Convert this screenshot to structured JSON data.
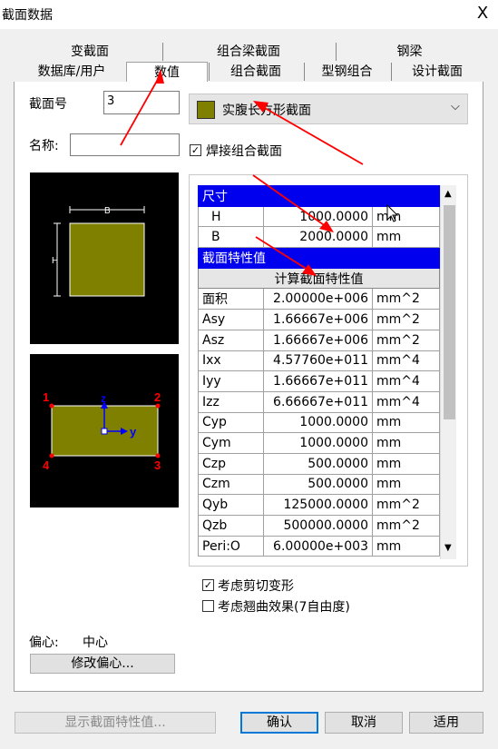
{
  "window": {
    "title": "截面数据",
    "close_glyph": "X"
  },
  "tabs_row1": [
    "变截面",
    "组合梁截面",
    "钢梁"
  ],
  "tabs_row2": [
    "数据库/用户",
    "数值",
    "组合截面",
    "型钢组合",
    "设计截面"
  ],
  "form": {
    "section_no_label": "截面号",
    "section_no_value": "3",
    "name_label": "名称:",
    "name_value": "",
    "section_type": "实腹长方形截面",
    "section_type_color": "#808000",
    "weld_check_label": "焊接组合截面",
    "weld_checked": true
  },
  "diagram1": {
    "dim_b": "B",
    "dim_h": "H",
    "rect_color": "#808000"
  },
  "diagram2": {
    "corners": [
      "1",
      "2",
      "3",
      "4"
    ],
    "axis_z": "z",
    "axis_y": "y",
    "corner_color": "#ff0000",
    "axis_color": "#0000ff"
  },
  "grid": {
    "dims_header": "尺寸",
    "dims": [
      {
        "name": "H",
        "value": "1000.0000",
        "unit": "mm"
      },
      {
        "name": "B",
        "value": "2000.0000",
        "unit": "mm"
      }
    ],
    "props_header": "截面特性值",
    "calc_button": "计算截面特性值",
    "props": [
      {
        "name": "面积",
        "value": "2.00000e+006",
        "unit": "mm^2"
      },
      {
        "name": "Asy",
        "value": "1.66667e+006",
        "unit": "mm^2"
      },
      {
        "name": "Asz",
        "value": "1.66667e+006",
        "unit": "mm^2"
      },
      {
        "name": "Ixx",
        "value": "4.57760e+011",
        "unit": "mm^4"
      },
      {
        "name": "Iyy",
        "value": "1.66667e+011",
        "unit": "mm^4"
      },
      {
        "name": "Izz",
        "value": "6.66667e+011",
        "unit": "mm^4"
      },
      {
        "name": "Cyp",
        "value": "1000.0000",
        "unit": "mm"
      },
      {
        "name": "Cym",
        "value": "1000.0000",
        "unit": "mm"
      },
      {
        "name": "Czp",
        "value": "500.0000",
        "unit": "mm"
      },
      {
        "name": "Czm",
        "value": "500.0000",
        "unit": "mm"
      },
      {
        "name": "Qyb",
        "value": "125000.0000",
        "unit": "mm^2"
      },
      {
        "name": "Qzb",
        "value": "500000.0000",
        "unit": "mm^2"
      },
      {
        "name": "Peri:O",
        "value": "6.00000e+003",
        "unit": "mm"
      }
    ]
  },
  "options": {
    "shear_label": "考虑剪切变形",
    "shear_checked": true,
    "warp_label": "考虑翘曲效果(7自由度)",
    "warp_checked": false
  },
  "eccentric": {
    "label": "偏心:",
    "value": "中心",
    "modify_button": "修改偏心..."
  },
  "bottom": {
    "show_props": "显示截面特性值...",
    "ok": "确认",
    "cancel": "取消",
    "apply": "适用"
  },
  "annotation_color": "#ff0000"
}
